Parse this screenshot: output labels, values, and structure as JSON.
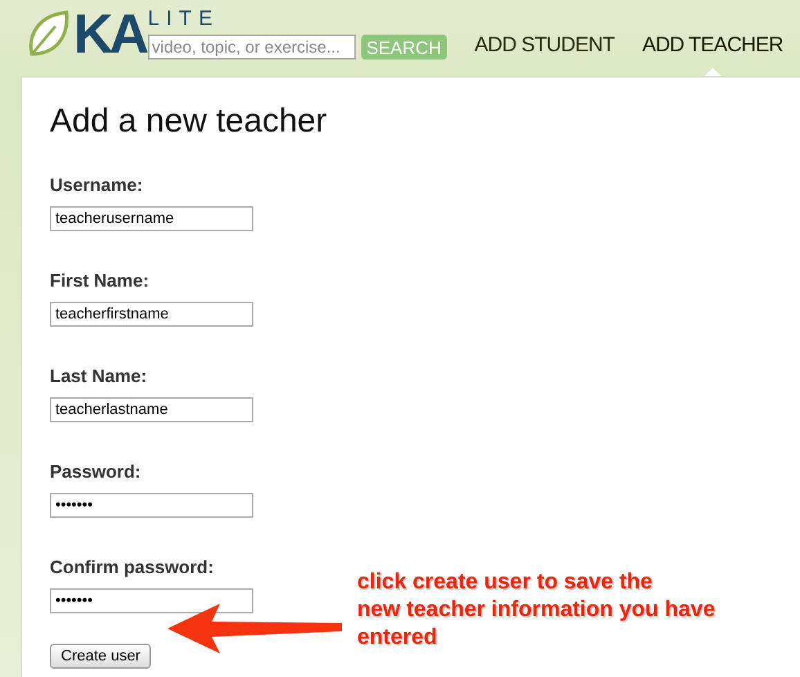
{
  "header": {
    "logo": {
      "mark": "KA",
      "word": "LITE"
    },
    "search": {
      "placeholder": "video, topic, or exercise...",
      "button": "SEARCH"
    },
    "nav": [
      {
        "label": "ADD STUDENT",
        "selected": false
      },
      {
        "label": "ADD TEACHER",
        "selected": true
      }
    ]
  },
  "form": {
    "title": "Add a new teacher",
    "fields": [
      {
        "label": "Username:",
        "value": "teacherusername"
      },
      {
        "label": "First Name:",
        "value": "teacherfirstname"
      },
      {
        "label": "Last Name:",
        "value": "teacherlastname"
      },
      {
        "label": "Password:",
        "value": "•••••••"
      },
      {
        "label": "Confirm password:",
        "value": "•••••••"
      }
    ],
    "submit": "Create user"
  },
  "annotation": {
    "text": "click create user to save the\nnew teacher information you have\nentered"
  }
}
